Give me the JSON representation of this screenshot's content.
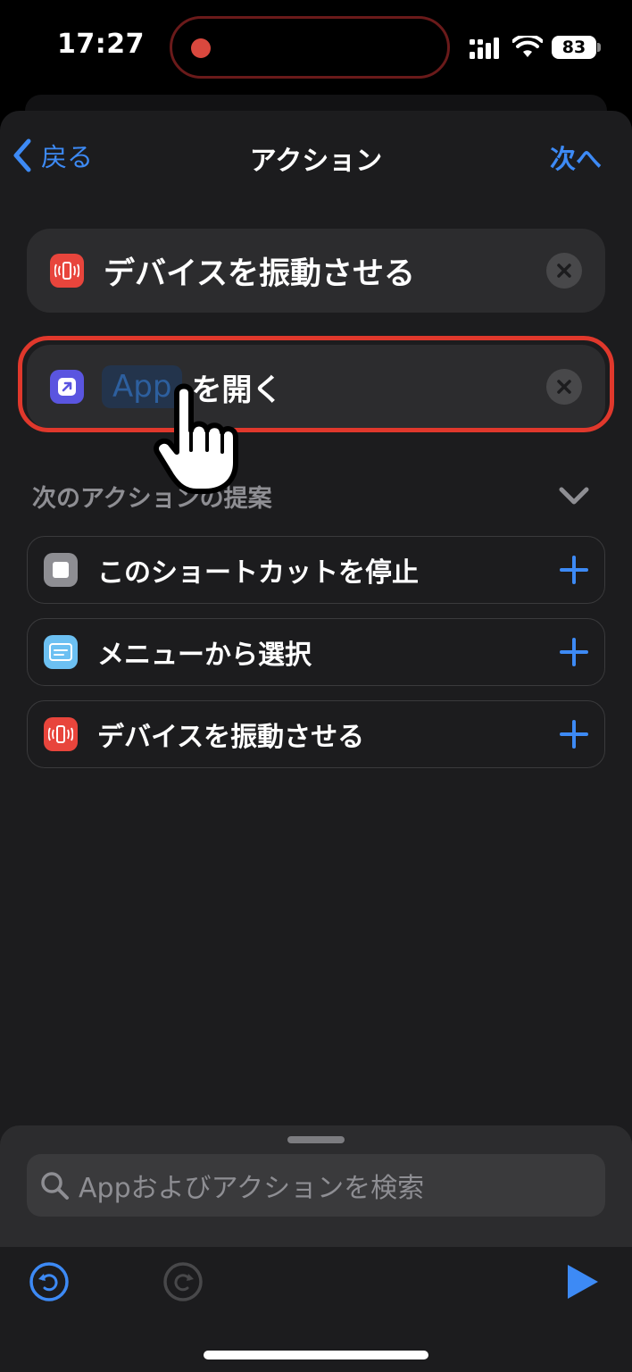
{
  "status": {
    "time": "17:27",
    "battery": "83"
  },
  "nav": {
    "back_label": "戻る",
    "title": "アクション",
    "next_label": "次へ"
  },
  "actions": [
    {
      "label": "デバイスを振動させる",
      "icon": "vibrate-icon",
      "color": "#e8453c"
    },
    {
      "token": "App",
      "label": "を開く",
      "icon": "open-app-icon",
      "color": "#5a55e0"
    }
  ],
  "suggestions": {
    "header": "次のアクションの提案",
    "items": [
      {
        "label": "このショートカットを停止",
        "icon": "stop-icon",
        "color": "#8e8e93"
      },
      {
        "label": "メニューから選択",
        "icon": "menu-icon",
        "color": "#6cc0f2"
      },
      {
        "label": "デバイスを振動させる",
        "icon": "vibrate-icon",
        "color": "#e8453c"
      }
    ]
  },
  "search": {
    "placeholder": "Appおよびアクションを検索"
  },
  "colors": {
    "accent": "#3d8af5",
    "highlight": "#e0382c",
    "background": "#1c1c1e"
  }
}
